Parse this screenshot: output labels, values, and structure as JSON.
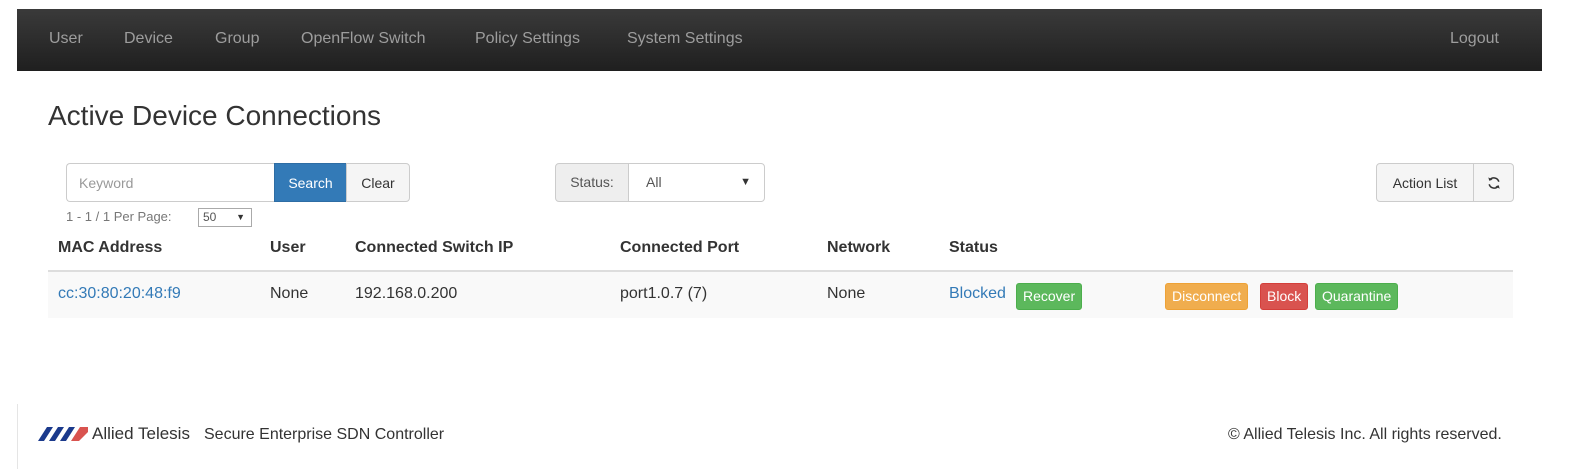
{
  "nav": {
    "items": [
      "User",
      "Device",
      "Group",
      "OpenFlow Switch",
      "Policy Settings",
      "System Settings"
    ],
    "logout": "Logout"
  },
  "page": {
    "title": "Active Device Connections"
  },
  "search": {
    "placeholder": "Keyword",
    "search_label": "Search",
    "clear_label": "Clear"
  },
  "status_filter": {
    "label": "Status:",
    "selected": "All"
  },
  "actions": {
    "action_list_label": "Action List",
    "refresh_icon": "refresh-icon"
  },
  "pagination": {
    "range": "1 - 1 / 1",
    "per_page_label": "Per Page:",
    "per_page_value": "50"
  },
  "table": {
    "columns": [
      "MAC Address",
      "User",
      "Connected Switch IP",
      "Connected Port",
      "Network",
      "Status"
    ],
    "rows": [
      {
        "mac": "cc:30:80:20:48:f9",
        "user": "None",
        "switch_ip": "192.168.0.200",
        "port": "port1.0.7 (7)",
        "network": "None",
        "status": "Blocked",
        "recover_label": "Recover",
        "disconnect_label": "Disconnect",
        "block_label": "Block",
        "quarantine_label": "Quarantine"
      }
    ]
  },
  "footer": {
    "brand": "Allied Telesis",
    "product": "Secure Enterprise SDN Controller",
    "copyright": "© Allied Telesis Inc. All rights reserved."
  },
  "colors": {
    "navbar": "#222222",
    "primary": "#337ab7",
    "success": "#5cb85c",
    "warning": "#f0ad4e",
    "danger": "#d9534f",
    "logo": "#1b3a8c"
  }
}
